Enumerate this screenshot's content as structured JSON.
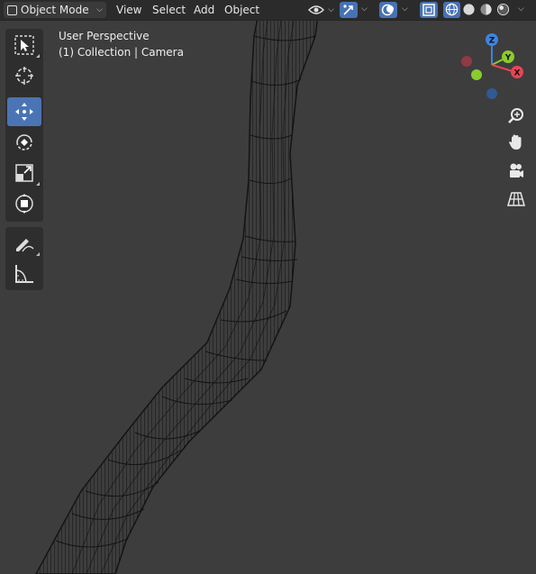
{
  "header": {
    "mode_label": "Object Mode",
    "menus": [
      "View",
      "Select",
      "Add",
      "Object"
    ]
  },
  "viewport": {
    "perspective": "User Perspective",
    "collection": "(1) Collection | Camera"
  },
  "gizmo": {
    "x_label": "X",
    "y_label": "Y",
    "z_label": "Z",
    "colors": {
      "x": "#e84456",
      "y": "#8acc2c",
      "z": "#3d84e0"
    }
  },
  "toolbar": {
    "tools": [
      "select-box",
      "cursor",
      "move",
      "rotate",
      "scale",
      "transform",
      "annotate",
      "measure"
    ],
    "active": "move"
  },
  "nav_buttons": [
    "zoom",
    "pan",
    "camera",
    "perspective-grid"
  ]
}
